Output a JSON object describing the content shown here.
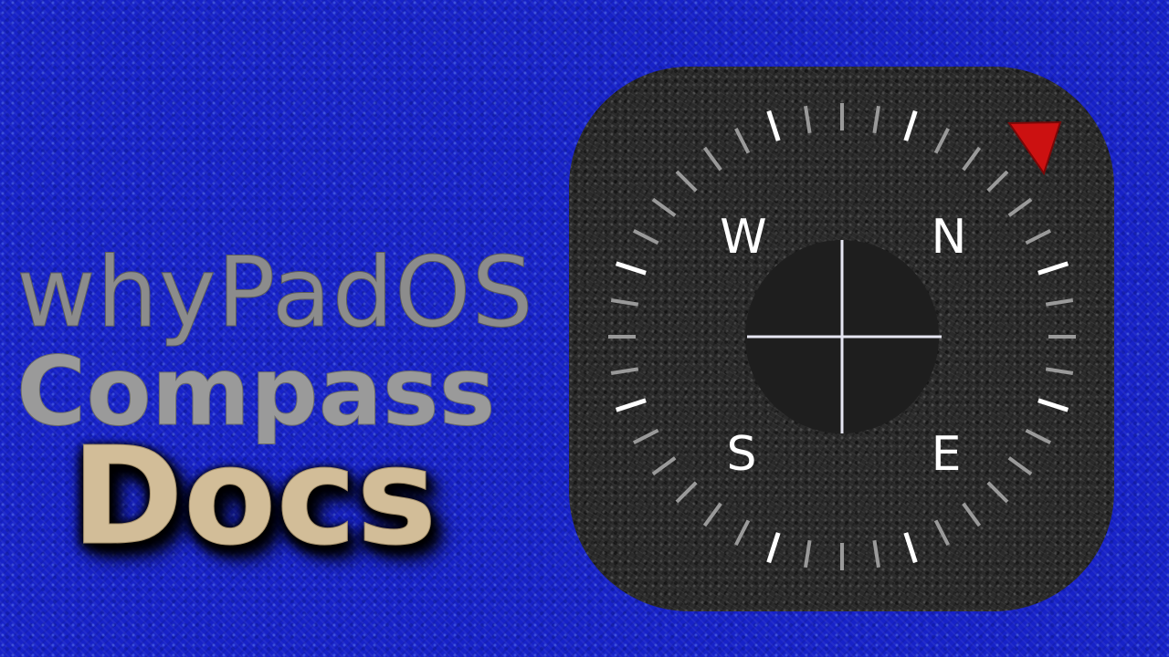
{
  "title": {
    "line1": "whyPadOS",
    "line2": "Compass",
    "line3": "Docs"
  },
  "app_icon": {
    "name": "compass-app-icon",
    "directions": {
      "north": "N",
      "east": "E",
      "south": "S",
      "west": "W"
    },
    "colors": {
      "background": "#1722c8",
      "icon_body": "#2b2b2b",
      "dial_center": "#1e1e1e",
      "crosshair": "#e6e6f2",
      "major_tick": "#ffffff",
      "minor_tick": "#9a9a9a",
      "pointer": "#cc1111"
    }
  }
}
